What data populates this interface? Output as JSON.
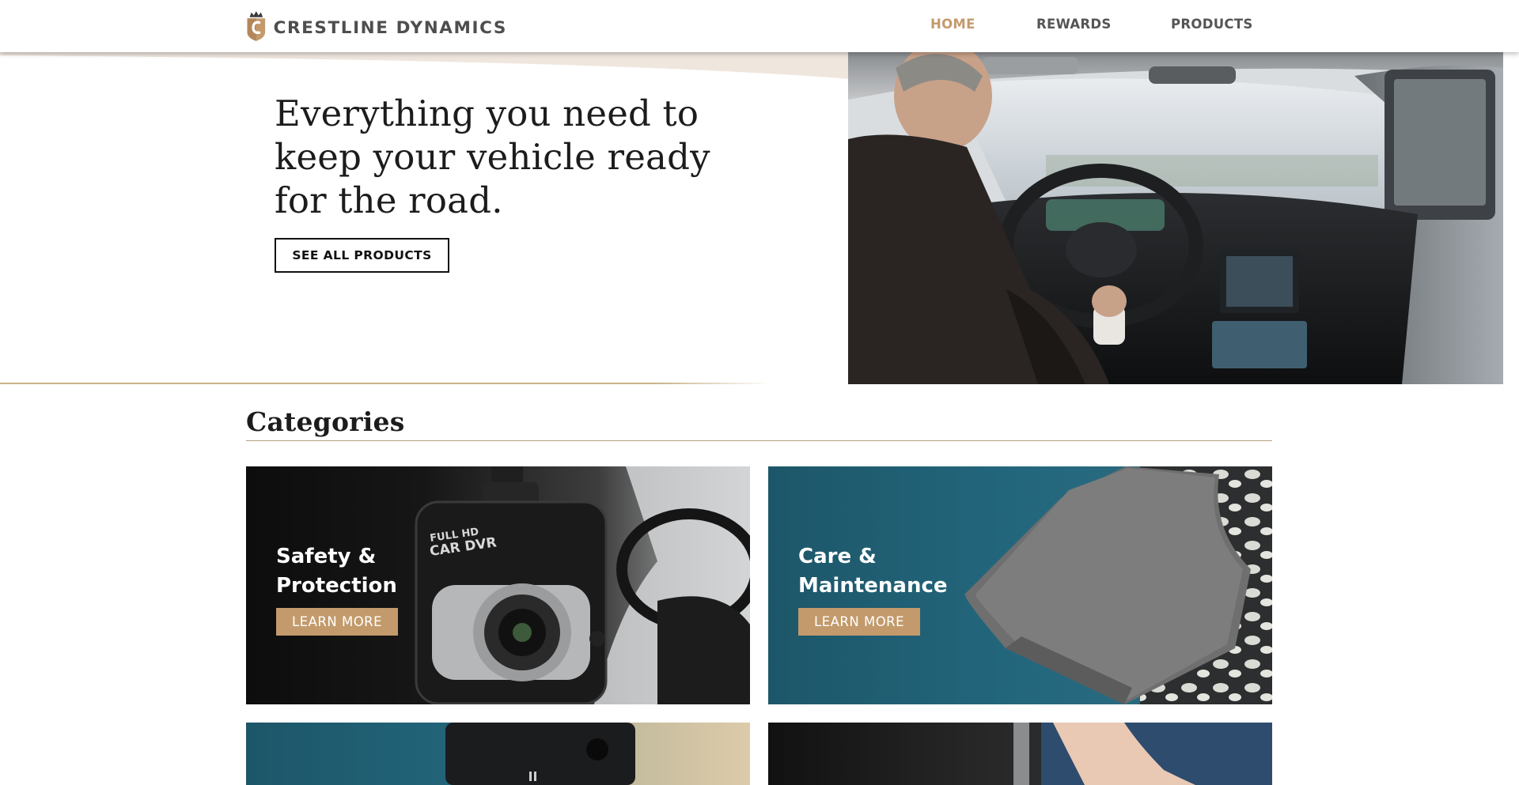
{
  "brand": {
    "name": "CRESTLINE DYNAMICS",
    "accent_color": "#c49a6c",
    "logo_icon": "crown-shield-logo"
  },
  "nav": {
    "items": [
      {
        "label": "HOME",
        "active": true
      },
      {
        "label": "REWARDS",
        "active": false
      },
      {
        "label": "PRODUCTS",
        "active": false
      }
    ]
  },
  "hero": {
    "heading": "Everything you need to keep your vehicle ready for the road.",
    "cta_label": "SEE ALL PRODUCTS",
    "image": "man-driving-car-interior-photo"
  },
  "categories": {
    "title": "Categories",
    "cards": [
      {
        "title": "Safety & Protection",
        "button": "LEARN MORE",
        "image": "dash-cam-photo",
        "bg_color": "#141414"
      },
      {
        "title": "Care & Maintenance",
        "button": "LEARN MORE",
        "image": "microfiber-towel-photo",
        "bg_color": "#1f5f73"
      },
      {
        "title": "",
        "button": "",
        "image": "radar-device-photo",
        "bg_color": "#1f5f73"
      },
      {
        "title": "",
        "button": "",
        "image": "car-cleaning-photo",
        "bg_color": "#141414"
      }
    ]
  }
}
